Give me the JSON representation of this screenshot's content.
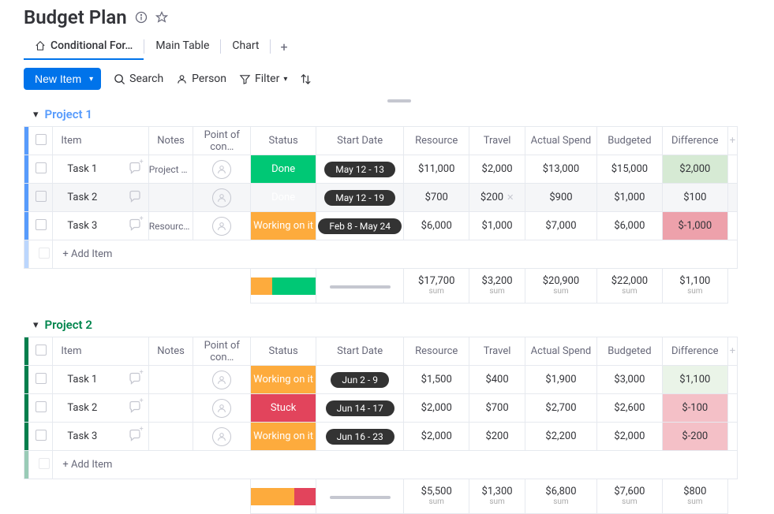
{
  "title": "Budget Plan",
  "tabs": {
    "conditional": "Conditional For…",
    "main_table": "Main Table",
    "chart": "Chart"
  },
  "toolbar": {
    "new_item": "New Item",
    "search": "Search",
    "person": "Person",
    "filter": "Filter"
  },
  "columns": {
    "item": "Item",
    "notes": "Notes",
    "point_of_contact": "Point of con…",
    "status": "Status",
    "start_date": "Start Date",
    "resource": "Resource",
    "travel": "Travel",
    "actual_spend": "Actual Spend",
    "budgeted": "Budgeted",
    "difference": "Difference"
  },
  "statuses": {
    "done": "Done",
    "working": "Working on it",
    "stuck": "Stuck"
  },
  "add_item_label": "+ Add Item",
  "sum_label": "sum",
  "groups": [
    {
      "name": "Project 1",
      "accent_class": "blue",
      "title_class": "blue",
      "rows": [
        {
          "item": "Task 1",
          "notes": "Project D…",
          "status": "done",
          "date": "May 12 - 13",
          "resource": "$11,000",
          "travel": "$2,000",
          "actual": "$13,000",
          "budgeted": "$15,000",
          "diff": "$2,000",
          "diff_class": "diff-pos",
          "hover": false,
          "chat": "plus",
          "travel_close": false
        },
        {
          "item": "Task 2",
          "notes": "",
          "status": "done",
          "date": "May 12 - 19",
          "resource": "$700",
          "travel": "$200",
          "actual": "$900",
          "budgeted": "$1,000",
          "diff": "$100",
          "diff_class": "diff-pos-light",
          "hover": true,
          "chat": "bubble",
          "travel_close": true
        },
        {
          "item": "Task 3",
          "notes": "Resource …",
          "status": "working",
          "date": "Feb 8 - May 24",
          "resource": "$6,000",
          "travel": "$1,000",
          "actual": "$7,000",
          "budgeted": "$6,000",
          "diff": "$-1,000",
          "diff_class": "diff-neg-strong",
          "hover": false,
          "chat": "plus",
          "travel_close": false
        }
      ],
      "status_bar": [
        {
          "class": "status-working",
          "pct": 33
        },
        {
          "class": "status-done",
          "pct": 67
        }
      ],
      "sums": {
        "resource": "$17,700",
        "travel": "$3,200",
        "actual": "$20,900",
        "budgeted": "$22,000",
        "diff": "$1,100"
      }
    },
    {
      "name": "Project 2",
      "accent_class": "dark-green",
      "title_class": "green",
      "rows": [
        {
          "item": "Task 1",
          "notes": "",
          "status": "working",
          "date": "Jun 2 - 9",
          "resource": "$1,500",
          "travel": "$400",
          "actual": "$1,900",
          "budgeted": "$3,000",
          "diff": "$1,100",
          "diff_class": "diff-pos-light",
          "hover": false,
          "chat": "plus",
          "travel_close": false
        },
        {
          "item": "Task 2",
          "notes": "",
          "status": "stuck",
          "date": "Jun 14 - 17",
          "resource": "$2,000",
          "travel": "$700",
          "actual": "$2,700",
          "budgeted": "$2,600",
          "diff": "$-100",
          "diff_class": "diff-neg",
          "hover": false,
          "chat": "plus",
          "travel_close": false
        },
        {
          "item": "Task 3",
          "notes": "",
          "status": "working",
          "date": "Jun 16 - 23",
          "resource": "$2,000",
          "travel": "$200",
          "actual": "$2,200",
          "budgeted": "$2,000",
          "diff": "$-200",
          "diff_class": "diff-neg",
          "hover": false,
          "chat": "plus",
          "travel_close": false
        }
      ],
      "status_bar": [
        {
          "class": "status-working",
          "pct": 67
        },
        {
          "class": "status-stuck",
          "pct": 33
        }
      ],
      "sums": {
        "resource": "$5,500",
        "travel": "$1,300",
        "actual": "$6,800",
        "budgeted": "$7,600",
        "diff": "$800"
      }
    }
  ]
}
